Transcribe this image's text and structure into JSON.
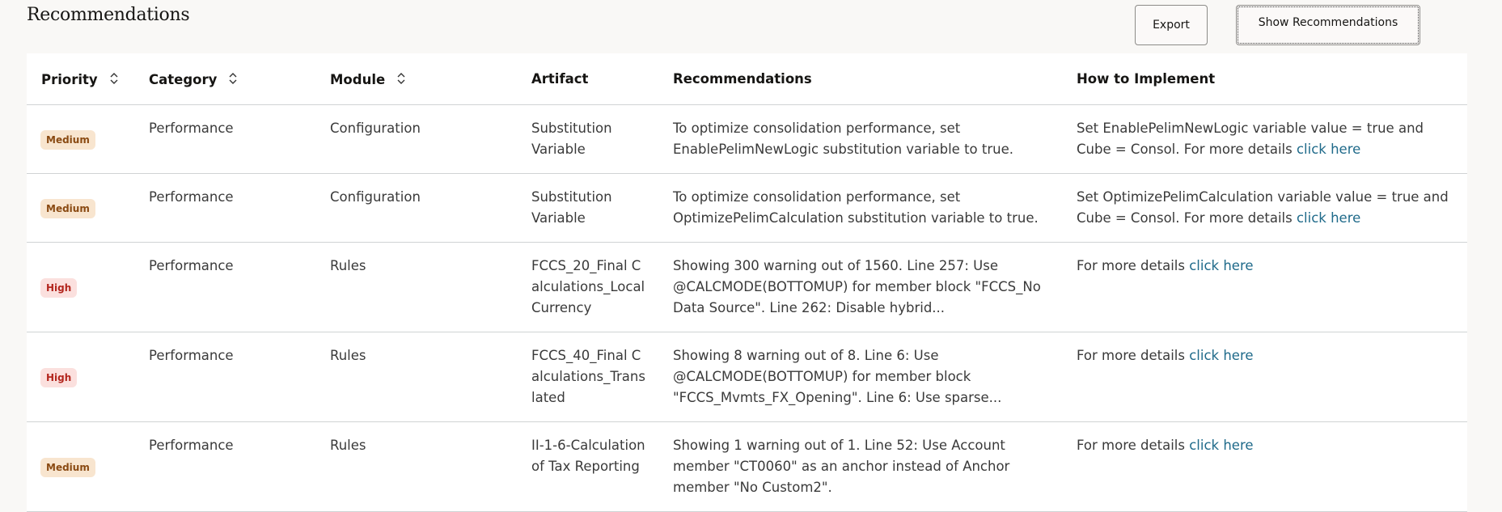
{
  "page": {
    "title": "Recommendations"
  },
  "toolbar": {
    "export_label": "Export",
    "show_recommendations_label": "Show Recommendations"
  },
  "table": {
    "columns": [
      {
        "label": "Priority",
        "sortable": true,
        "icon": "sort-icon"
      },
      {
        "label": "Category",
        "sortable": true,
        "icon": "sort-icon"
      },
      {
        "label": "Module",
        "sortable": true,
        "icon": "sort-icon"
      },
      {
        "label": "Artifact",
        "sortable": false
      },
      {
        "label": "Recommendations",
        "sortable": false
      },
      {
        "label": "How to Implement",
        "sortable": false
      }
    ],
    "rows": [
      {
        "priority": "Medium",
        "category": "Performance",
        "module": "Configuration",
        "artifact": "Substitution Variable",
        "recommendation": "To optimize consolidation performance, set EnablePelimNewLogic substitution variable to true.",
        "how_text": "Set EnablePelimNewLogic variable value = true and Cube = Consol. For more details ",
        "how_link": "click here"
      },
      {
        "priority": "Medium",
        "category": "Performance",
        "module": "Configuration",
        "artifact": "Substitution Variable",
        "recommendation": "To optimize consolidation performance, set OptimizePelimCalculation substitution variable to true.",
        "how_text": "Set OptimizePelimCalculation variable value = true and Cube = Consol. For more details ",
        "how_link": "click here"
      },
      {
        "priority": "High",
        "category": "Performance",
        "module": "Rules",
        "artifact": "FCCS_20_Final Calculations_LocalCurrency",
        "recommendation": "Showing 300 warning out of 1560. Line 257: Use @CALCMODE(BOTTOMUP) for member block \"FCCS_No Data Source\". Line 262: Disable hybrid...",
        "how_text": "For more details ",
        "how_link": "click here"
      },
      {
        "priority": "High",
        "category": "Performance",
        "module": "Rules",
        "artifact": "FCCS_40_Final Calculations_Translated",
        "recommendation": "Showing 8 warning out of 8. Line 6: Use @CALCMODE(BOTTOMUP) for member block \"FCCS_Mvmts_FX_Opening\". Line 6: Use sparse...",
        "how_text": "For more details ",
        "how_link": "click here"
      },
      {
        "priority": "Medium",
        "category": "Performance",
        "module": "Rules",
        "artifact": "II-1-6-Calculation of Tax Reporting",
        "recommendation": "Showing 1 warning out of 1. Line 52: Use Account member \"CT0060\" as an anchor instead of Anchor member \"No Custom2\".",
        "how_text": "For more details ",
        "how_link": "click here"
      }
    ]
  },
  "colors": {
    "medium_badge_bg": "#f8e5cf",
    "medium_badge_text": "#8a4a12",
    "high_badge_bg": "#fbe0de",
    "high_badge_text": "#b3261e",
    "link": "#1f6a8a"
  }
}
